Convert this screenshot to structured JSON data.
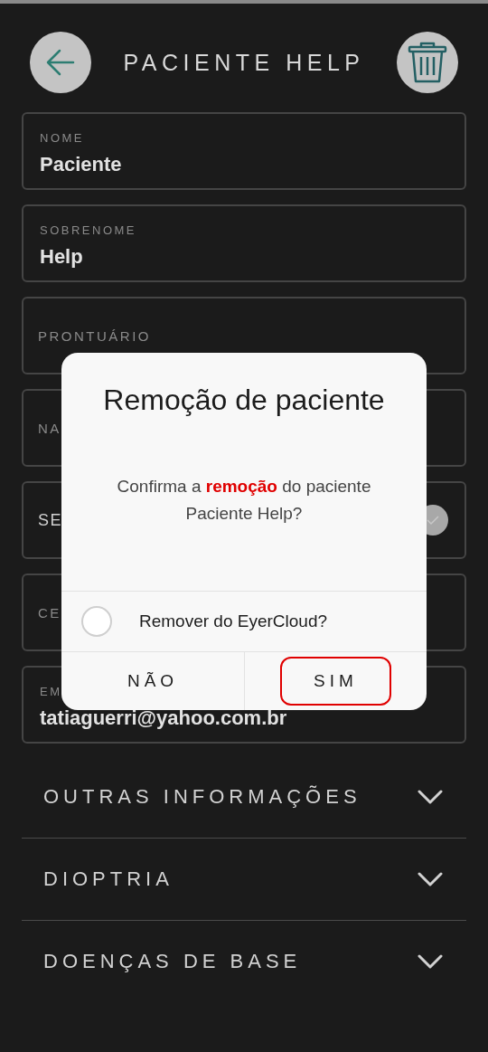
{
  "header": {
    "title": "PACIENTE HELP"
  },
  "fields": [
    {
      "kind": "filled",
      "label": "NOME",
      "value": "Paciente"
    },
    {
      "kind": "filled",
      "label": "SOBRENOME",
      "value": "Help"
    },
    {
      "kind": "empty",
      "label": "PRONTUÁRIO"
    },
    {
      "kind": "empty",
      "label": "NA"
    },
    {
      "kind": "select",
      "label": "SE"
    },
    {
      "kind": "empty",
      "label": "CE"
    },
    {
      "kind": "filled",
      "label": "EM",
      "value": "tatiaguerri@yahoo.com.br"
    }
  ],
  "sections": [
    {
      "label": "OUTRAS INFORMAÇÕES",
      "expanded": false
    },
    {
      "label": "DIOPTRIA",
      "expanded": false
    },
    {
      "label": "DOENÇAS DE BASE",
      "expanded": false
    }
  ],
  "dialog": {
    "title": "Remoção de paciente",
    "message": "Confirma a **remoção** do paciente Paciente Help?",
    "option": {
      "label": "Remover do EyerCloud?",
      "checked": false
    },
    "buttons": [
      {
        "label": "NÃO",
        "focused": false
      },
      {
        "label": "SIM",
        "focused": true
      }
    ]
  }
}
